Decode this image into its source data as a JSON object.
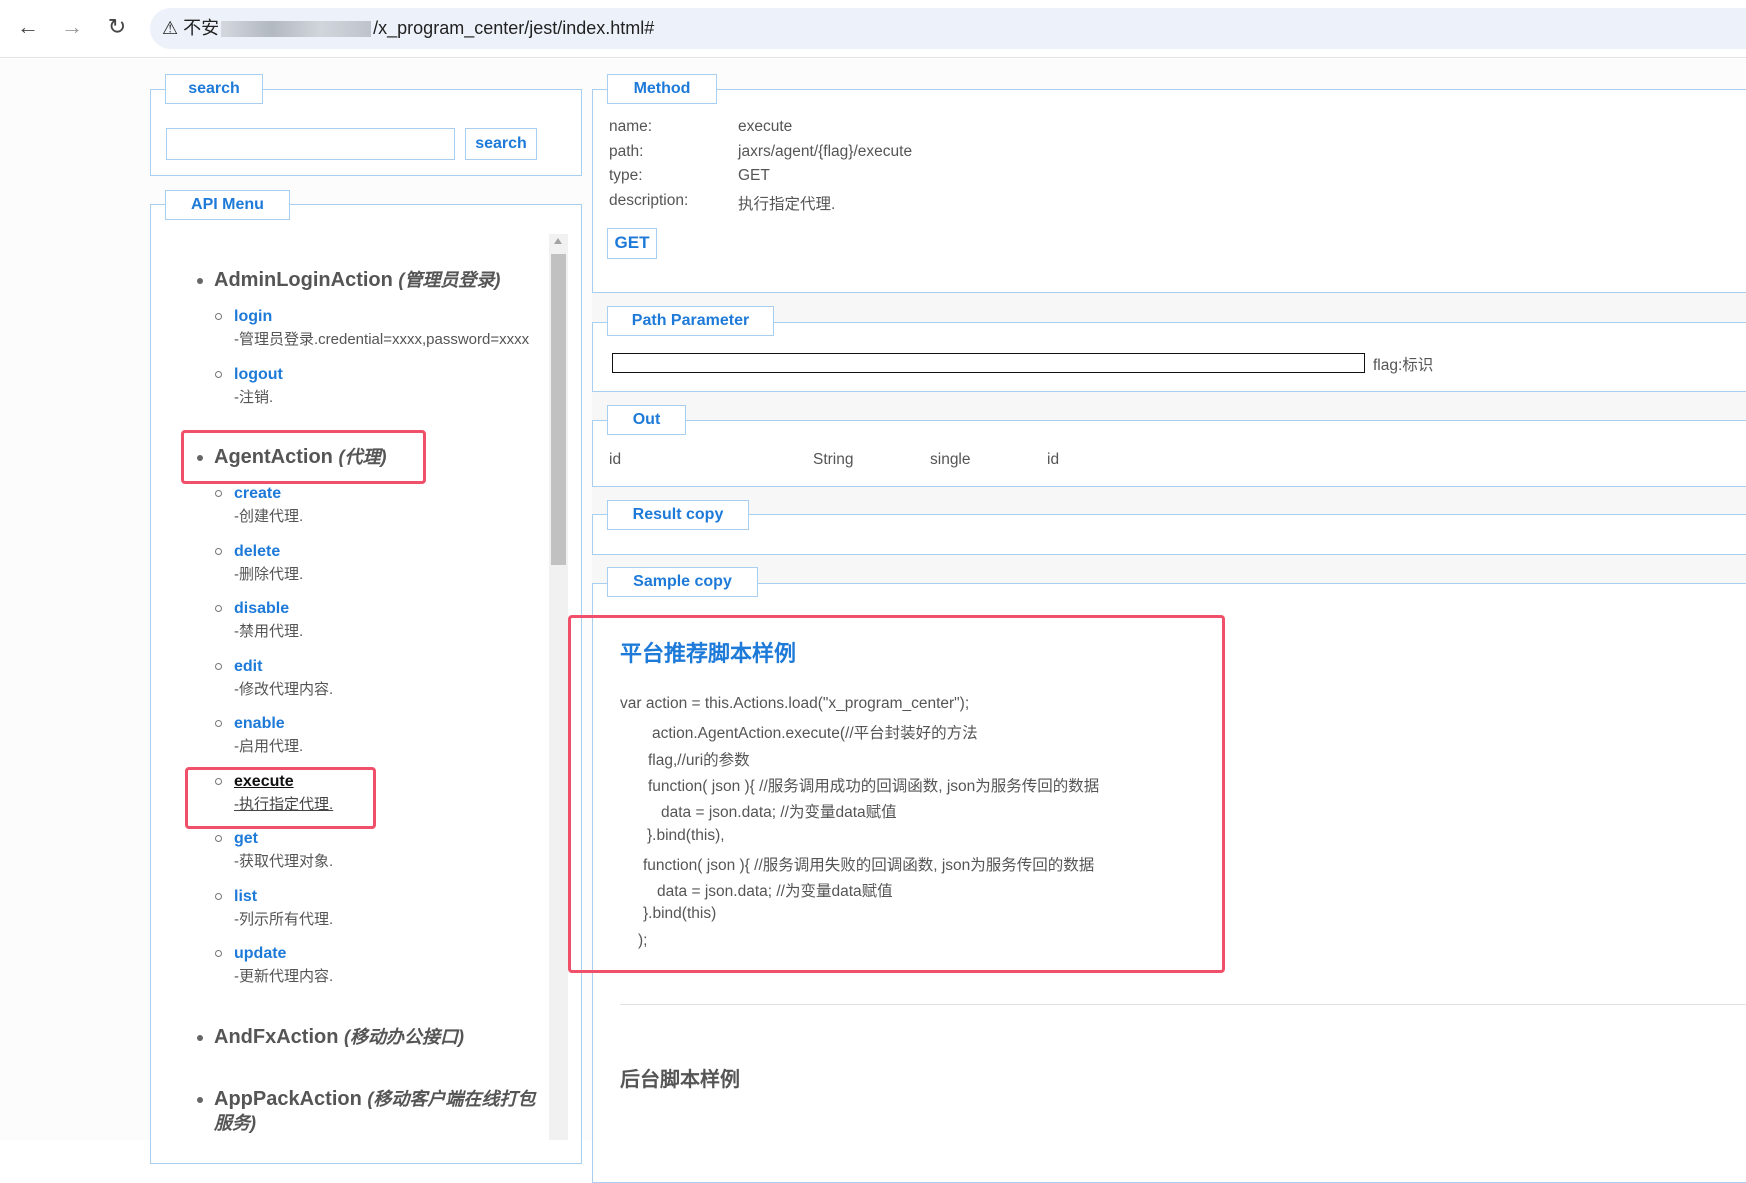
{
  "browser": {
    "url_prefix": "不安",
    "url_path": "/x_program_center/jest/index.html#"
  },
  "search": {
    "legend": "search",
    "input_value": "",
    "button": "search"
  },
  "menu": {
    "legend": "API Menu",
    "groups": [
      {
        "name": "AdminLoginAction",
        "cn": "(管理员登录)",
        "items": [
          {
            "name": "login",
            "desc": "-管理员登录.credential=xxxx,password=xxxx"
          },
          {
            "name": "logout",
            "desc": "-注销."
          }
        ]
      },
      {
        "name": "AgentAction",
        "cn": "(代理)",
        "items": [
          {
            "name": "create",
            "desc": "-创建代理."
          },
          {
            "name": "delete",
            "desc": "-删除代理."
          },
          {
            "name": "disable",
            "desc": "-禁用代理."
          },
          {
            "name": "edit",
            "desc": "-修改代理内容."
          },
          {
            "name": "enable",
            "desc": "-启用代理."
          },
          {
            "name": "execute",
            "desc": "-执行指定代理."
          },
          {
            "name": "get",
            "desc": "-获取代理对象."
          },
          {
            "name": "list",
            "desc": "-列示所有代理."
          },
          {
            "name": "update",
            "desc": "-更新代理内容."
          }
        ]
      },
      {
        "name": "AndFxAction",
        "cn": "(移动办公接口)",
        "items": []
      },
      {
        "name": "AppPackAction",
        "cn": "(移动客户端在线打包服务)",
        "items": []
      }
    ]
  },
  "method": {
    "legend": "Method",
    "rows": [
      {
        "label": "name:",
        "value": "execute"
      },
      {
        "label": "path:",
        "value": "jaxrs/agent/{flag}/execute"
      },
      {
        "label": "type:",
        "value": "GET"
      },
      {
        "label": "description:",
        "value": "执行指定代理."
      }
    ],
    "button": "GET"
  },
  "path_parameter": {
    "legend": "Path Parameter",
    "input_value": "",
    "label": "flag:标识"
  },
  "out": {
    "legend": "Out",
    "row": [
      "id",
      "String",
      "single",
      "id"
    ]
  },
  "result": {
    "legend": "Result copy"
  },
  "sample": {
    "legend": "Sample copy",
    "heading": "平台推荐脚本样例",
    "code": [
      "var action = this.Actions.load(\"x_program_center\");",
      "action.AgentAction.execute(//平台封装好的方法",
      "flag,//uri的参数",
      "function( json ){ //服务调用成功的回调函数, json为服务传回的数据",
      "data = json.data; //为变量data赋值",
      "}.bind(this),",
      "function( json ){ //服务调用失败的回调函数, json为服务传回的数据",
      "data = json.data; //为变量data赋值",
      "}.bind(this)",
      ");"
    ],
    "heading2": "后台脚本样例"
  }
}
